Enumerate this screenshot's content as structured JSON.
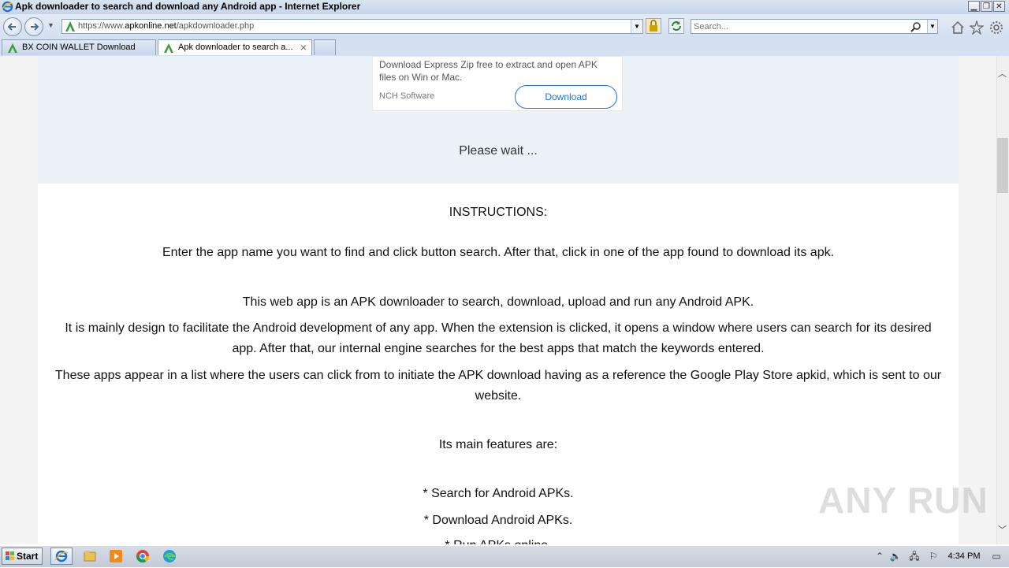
{
  "window": {
    "title": "Apk downloader to search and download any Android app - Internet Explorer"
  },
  "address_bar": {
    "url_prefix": "https://www.",
    "url_domain": "apkonline.net",
    "url_path": "/apkdownloader.php"
  },
  "search": {
    "placeholder": "Search..."
  },
  "tabs": [
    {
      "label": "BX COIN WALLET Download",
      "active": false
    },
    {
      "label": "Apk downloader to search a...",
      "active": true
    }
  ],
  "ad": {
    "description": "Download Express Zip free to extract and open APK files on Win or Mac.",
    "brand": "NCH Software",
    "button_label": "Download"
  },
  "status": {
    "please_wait": "Please wait ..."
  },
  "content": {
    "heading": "INSTRUCTIONS:",
    "p1": "Enter the app name you want to find and click button search. After that, click in one of the app found to download its apk.",
    "p2": "This web app is an APK downloader to search, download, upload and run any Android APK.",
    "p3": "It is mainly design to facilitate the Android development of any app. When the extension is clicked, it opens a window where users can search for its desired app. After that, our internal engine searches for the best apps that match the keywords entered.",
    "p4": "These apps appear in a list where the users can click from to initiate the APK download having as a reference the Google Play Store apkid, which is sent to our website.",
    "features_heading": "Its main features are:",
    "features": [
      "* Search for Android APKs.",
      "* Download Android APKs.",
      "* Run APKs online."
    ]
  },
  "watermark": "ANY RUN",
  "taskbar": {
    "start_label": "Start",
    "clock": "4:34 PM"
  },
  "colors": {
    "accent": "#1a73e8",
    "page_blue": "#eaf2f8",
    "favicon_green": "#3a9a3a"
  }
}
